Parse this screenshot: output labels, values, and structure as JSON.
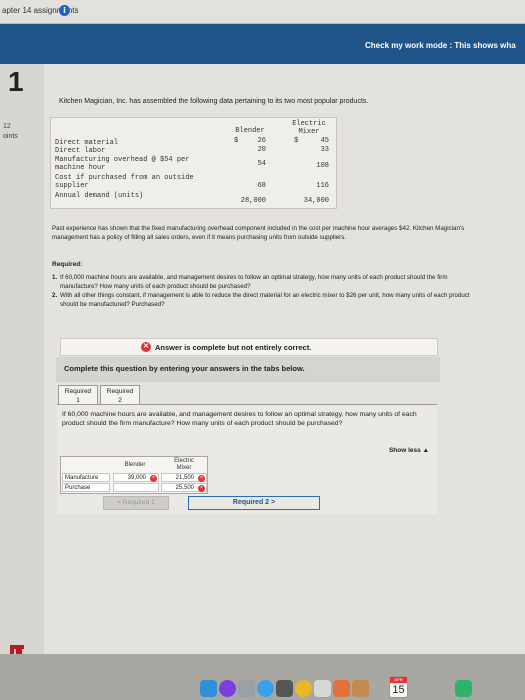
{
  "header": {
    "assignment_title": "apter 14 assignments",
    "info_icon": "info-icon",
    "check_mode": "Check my work mode : This shows wha"
  },
  "question": {
    "number": "1",
    "points_value": "12",
    "points_label": "oints",
    "intro": "Kitchen Magician, Inc. has assembled the following data pertaining to its two most popular products."
  },
  "data_table": {
    "col_blender": "Blender",
    "col_mixer_line1": "Electric",
    "col_mixer_line2": "Mixer",
    "rows": [
      {
        "label": "Direct material",
        "cur_blender": "$",
        "blender": "26",
        "cur_mixer": "$",
        "mixer": "45"
      },
      {
        "label": "Direct labor",
        "blender": "20",
        "mixer": "33"
      },
      {
        "label_line1": "Manufacturing overhead @ $54 per",
        "label_line2": "machine hour",
        "blender": "54",
        "mixer": "108"
      },
      {
        "label_line1": "Cost if purchased from an outside",
        "label_line2": "supplier",
        "blender": "68",
        "mixer": "116"
      },
      {
        "label": "Annual demand (units)",
        "blender": "28,000",
        "mixer": "34,000"
      }
    ]
  },
  "paragraph": "Past experience has shown that the fixed manufacturing overhead component included in the cost per machine hour averages $42. Kitchen Magician's management has a policy of filling all sales orders, even if it means purchasing units from outside suppliers.",
  "required": {
    "heading": "Required:",
    "items": [
      {
        "num": "1.",
        "text": "If 60,000 machine hours are available, and management desires to follow an optimal strategy, how many units of each product should the firm manufacture? How many units of each product should be purchased?"
      },
      {
        "num": "2.",
        "text": "With all other things constant, if management is able to reduce the direct material for an electric mixer to $26 per unit, how many units of each product should be manufactured? Purchased?"
      }
    ]
  },
  "status": {
    "banner": "Answer is complete but not entirely correct.",
    "instruction": "Complete this question by entering your answers in the tabs below."
  },
  "tabs": [
    {
      "line1": "Required",
      "line2": "1"
    },
    {
      "line1": "Required",
      "line2": "2"
    }
  ],
  "panel": {
    "question": "If 60,000 machine hours are available, and management desires to follow an optimal strategy, how many units of each product should the firm manufacture? How many units of each product should be purchased?",
    "show_less": "Show less ▲",
    "col_blender": "Blender",
    "col_mixer_line1": "Electric",
    "col_mixer_line2": "Mixer",
    "rows": [
      {
        "label": "Manufacture",
        "blender": "39,000",
        "mixer": "21,500"
      },
      {
        "label": "Purchase",
        "blender": "",
        "mixer": "25,500"
      }
    ],
    "error_mark": "×"
  },
  "nav": {
    "prev": "< Required 1",
    "next": "Required 2 >"
  },
  "dock": {
    "calendar_month": "APR",
    "calendar_day": "15",
    "icons": [
      "finder-icon",
      "siri-icon",
      "launchpad-icon",
      "safari-icon",
      "rocket-icon",
      "chrome-icon",
      "mail-icon",
      "photos-icon",
      "contacts-icon",
      "calendar-icon",
      "notes-icon"
    ]
  }
}
